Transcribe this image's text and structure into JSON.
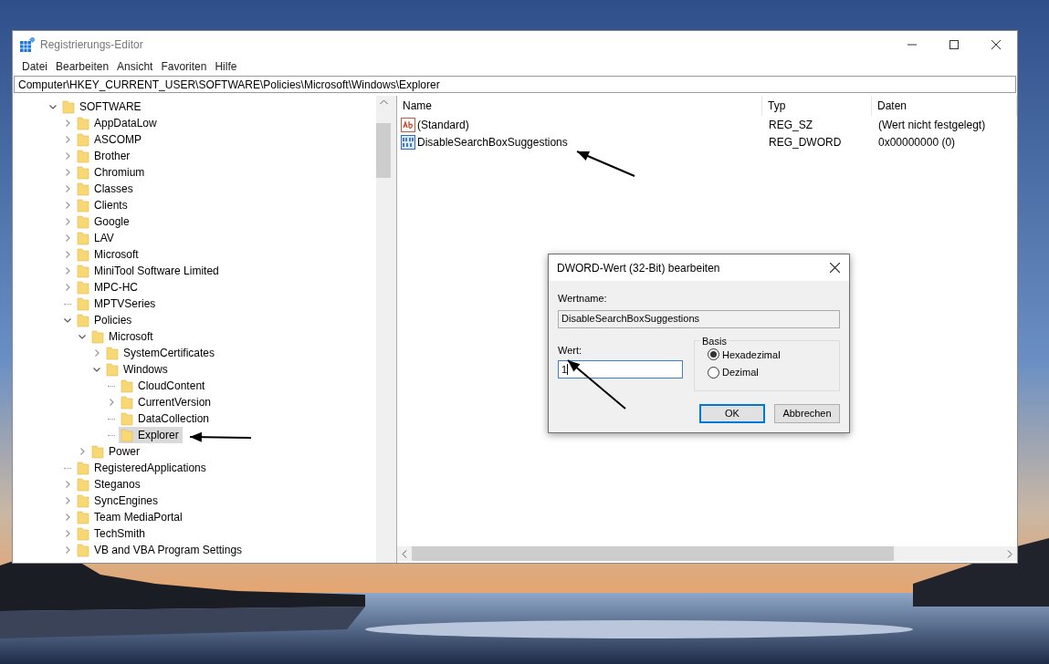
{
  "window": {
    "title": "Registrierungs-Editor"
  },
  "menu": [
    "Datei",
    "Bearbeiten",
    "Ansicht",
    "Favoriten",
    "Hilfe"
  ],
  "address": "Computer\\HKEY_CURRENT_USER\\SOFTWARE\\Policies\\Microsoft\\Windows\\Explorer",
  "tree": [
    {
      "label": "SOFTWARE",
      "expandable": true,
      "expanded": true,
      "selected": false,
      "children": [
        {
          "label": "AppDataLow",
          "expandable": true,
          "expanded": false,
          "selected": false
        },
        {
          "label": "ASCOMP",
          "expandable": true,
          "expanded": false,
          "selected": false
        },
        {
          "label": "Brother",
          "expandable": true,
          "expanded": false,
          "selected": false
        },
        {
          "label": "Chromium",
          "expandable": true,
          "expanded": false,
          "selected": false
        },
        {
          "label": "Classes",
          "expandable": true,
          "expanded": false,
          "selected": false
        },
        {
          "label": "Clients",
          "expandable": true,
          "expanded": false,
          "selected": false
        },
        {
          "label": "Google",
          "expandable": true,
          "expanded": false,
          "selected": false
        },
        {
          "label": "LAV",
          "expandable": true,
          "expanded": false,
          "selected": false
        },
        {
          "label": "Microsoft",
          "expandable": true,
          "expanded": false,
          "selected": false
        },
        {
          "label": "MiniTool Software Limited",
          "expandable": true,
          "expanded": false,
          "selected": false
        },
        {
          "label": "MPC-HC",
          "expandable": true,
          "expanded": false,
          "selected": false
        },
        {
          "label": "MPTVSeries",
          "expandable": false,
          "expanded": false,
          "selected": false
        },
        {
          "label": "Policies",
          "expandable": true,
          "expanded": true,
          "selected": false,
          "children": [
            {
              "label": "Microsoft",
              "expandable": true,
              "expanded": true,
              "selected": false,
              "children": [
                {
                  "label": "SystemCertificates",
                  "expandable": true,
                  "expanded": false,
                  "selected": false
                },
                {
                  "label": "Windows",
                  "expandable": true,
                  "expanded": true,
                  "selected": false,
                  "children": [
                    {
                      "label": "CloudContent",
                      "expandable": false,
                      "expanded": false,
                      "selected": false
                    },
                    {
                      "label": "CurrentVersion",
                      "expandable": true,
                      "expanded": false,
                      "selected": false
                    },
                    {
                      "label": "DataCollection",
                      "expandable": false,
                      "expanded": false,
                      "selected": false
                    },
                    {
                      "label": "Explorer",
                      "expandable": false,
                      "expanded": false,
                      "selected": true
                    }
                  ]
                }
              ]
            },
            {
              "label": "Power",
              "expandable": true,
              "expanded": false,
              "selected": false
            }
          ]
        },
        {
          "label": "RegisteredApplications",
          "expandable": false,
          "expanded": false,
          "selected": false
        },
        {
          "label": "Steganos",
          "expandable": true,
          "expanded": false,
          "selected": false
        },
        {
          "label": "SyncEngines",
          "expandable": true,
          "expanded": false,
          "selected": false
        },
        {
          "label": "Team MediaPortal",
          "expandable": true,
          "expanded": false,
          "selected": false
        },
        {
          "label": "TechSmith",
          "expandable": true,
          "expanded": false,
          "selected": false
        },
        {
          "label": "VB and VBA Program Settings",
          "expandable": true,
          "expanded": false,
          "selected": false
        }
      ]
    }
  ],
  "values_table": {
    "columns": [
      "Name",
      "Typ",
      "Daten"
    ],
    "rows": [
      {
        "kind": "string",
        "name": "(Standard)",
        "type": "REG_SZ",
        "data": "(Wert nicht festgelegt)"
      },
      {
        "kind": "dword",
        "name": "DisableSearchBoxSuggestions",
        "type": "REG_DWORD",
        "data": "0x00000000 (0)"
      }
    ]
  },
  "dialog": {
    "title": "DWORD-Wert (32-Bit) bearbeiten",
    "name_label": "Wertname:",
    "name_value": "DisableSearchBoxSuggestions",
    "value_label": "Wert:",
    "value": "1",
    "base_label": "Basis",
    "bases": [
      {
        "label": "Hexadezimal",
        "selected": true
      },
      {
        "label": "Dezimal",
        "selected": false
      }
    ],
    "buttons": [
      {
        "label": "OK",
        "default": true
      },
      {
        "label": "Abbrechen",
        "default": false
      }
    ]
  }
}
